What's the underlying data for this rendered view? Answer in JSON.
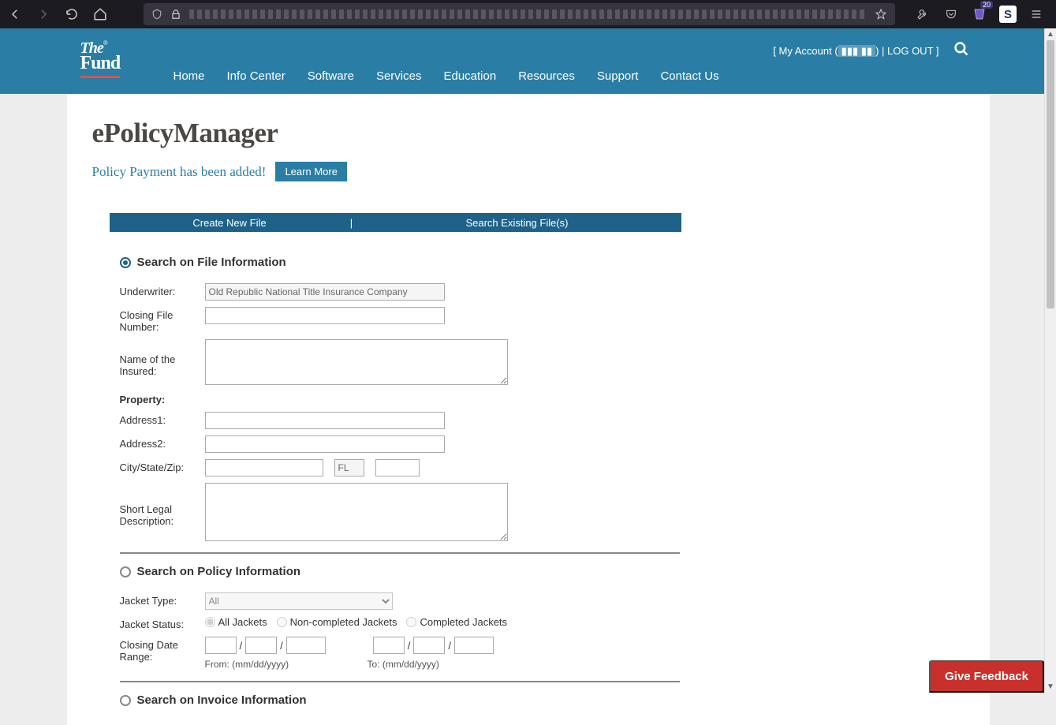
{
  "chrome": {
    "badge": "20",
    "s": "S"
  },
  "header": {
    "logo": {
      "the": "The",
      "fund": "Fund",
      "reg": "®"
    },
    "nav": [
      "Home",
      "Info Center",
      "Software",
      "Services",
      "Education",
      "Resources",
      "Support",
      "Contact Us"
    ],
    "account_open": "[  My Account (",
    "account_code": "▮▮▮  ▮▮",
    "account_sep": ") | ",
    "logout": "LOG OUT ]"
  },
  "page": {
    "title": "ePolicyManager",
    "notice": "Policy Payment has been added!",
    "learn": "Learn More",
    "tabs": {
      "create": "Create New File",
      "sep": "|",
      "search": "Search Existing File(s)"
    }
  },
  "section1": {
    "head": "Search on File Information",
    "labels": {
      "underwriter": "Underwriter:",
      "closingfile": "Closing File Number:",
      "insured": "Name of the Insured:",
      "property": "Property:",
      "address1": "Address1:",
      "address2": "Address2:",
      "csz": "City/State/Zip:",
      "state": "FL",
      "legal": "Short Legal Description:"
    },
    "underwriter_value": "Old Republic National Title Insurance Company"
  },
  "section2": {
    "head": "Search on Policy Information",
    "labels": {
      "jackettype": "Jacket Type:",
      "jacketstatus": "Jacket Status:",
      "closingdate": "Closing Date Range:"
    },
    "jacket_type_value": "All",
    "statuses": [
      "All Jackets",
      "Non-completed Jackets",
      "Completed Jackets"
    ],
    "slash": "/",
    "from_hint": "From: (mm/dd/yyyy)",
    "to_hint": "To: (mm/dd/yyyy)"
  },
  "section3": {
    "head": "Search on Invoice Information"
  },
  "feedback": "Give Feedback"
}
